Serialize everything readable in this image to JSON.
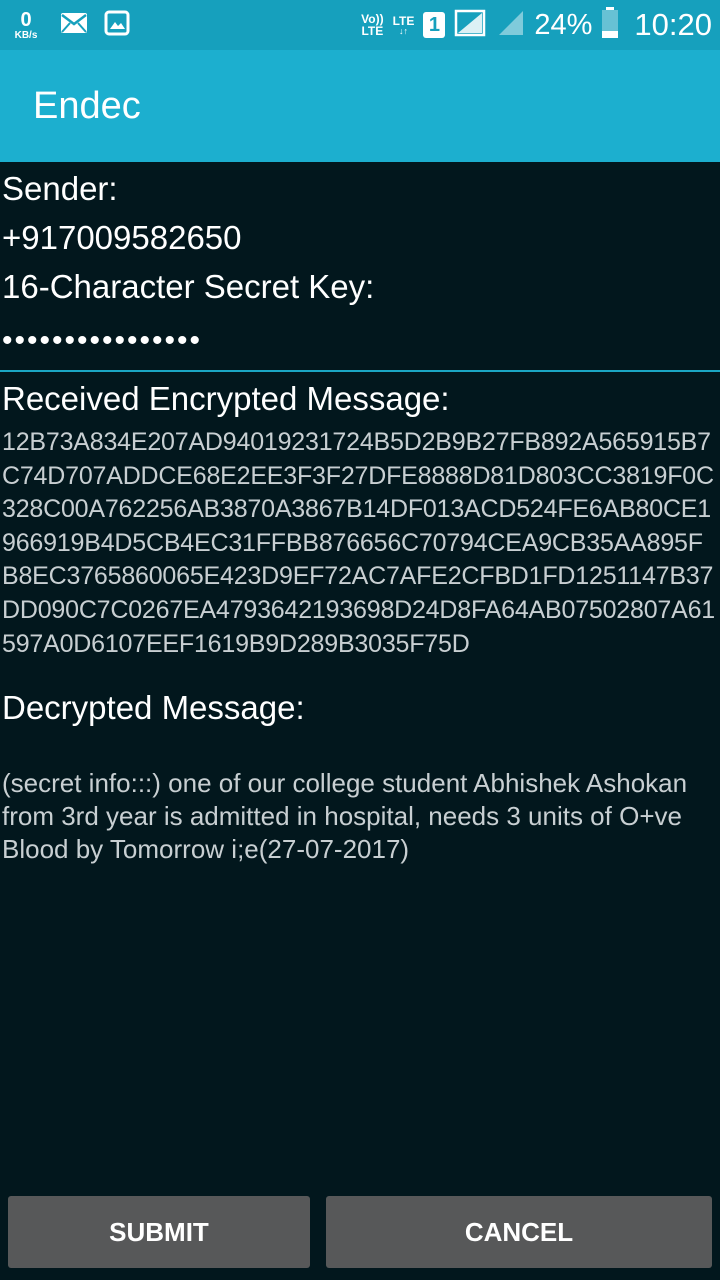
{
  "status_bar": {
    "net_speed_value": "0",
    "net_speed_unit": "KB/s",
    "volte_top": "Vo))",
    "volte_bottom": "LTE",
    "lte_top": "LTE",
    "lte_bottom": "↓↑",
    "sim_slot": "1",
    "battery_percent": "24%",
    "time": "10:20",
    "icons": [
      "mail-icon",
      "gallery-icon",
      "signal-icon",
      "battery-icon"
    ]
  },
  "app_bar": {
    "title": "Endec"
  },
  "form": {
    "sender_label": "Sender:",
    "sender_value": "+917009582650",
    "key_label": "16-Character Secret Key:",
    "key_value": "••••••••••••••••",
    "encrypted_label": "Received Encrypted Message:",
    "encrypted_value": "12B73A834E207AD94019231724B5D2B9B27FB892A565915B7C74D707ADDCE68E2EE3F3F27DFE8888D81D803CC3819F0C328C00A762256AB3870A3867B14DF013ACD524FE6AB80CE1966919B4D5CB4EC31FFBB876656C70794CEA9CB35AA895FB8EC3765860065E423D9EF72AC7AFE2CFBD1FD1251147B37DD090C7C0267EA4793642193698D24D8FA64AB07502807A61597A0D6107EEF1619B9D289B3035F75D",
    "decrypted_label": "Decrypted Message:",
    "decrypted_value": "(secret info:::) one of our college student Abhishek Ashokan from 3rd year is admitted in hospital, needs 3 units of O+ve Blood by Tomorrow i;e(27-07-2017)"
  },
  "buttons": {
    "submit_label": "SUBMIT",
    "cancel_label": "CANCEL"
  },
  "colors": {
    "status_bar": "#16a0bd",
    "app_bar": "#1cafcf",
    "background": "#02171d",
    "button": "#575859",
    "accent_underline": "#1ba7c4"
  }
}
